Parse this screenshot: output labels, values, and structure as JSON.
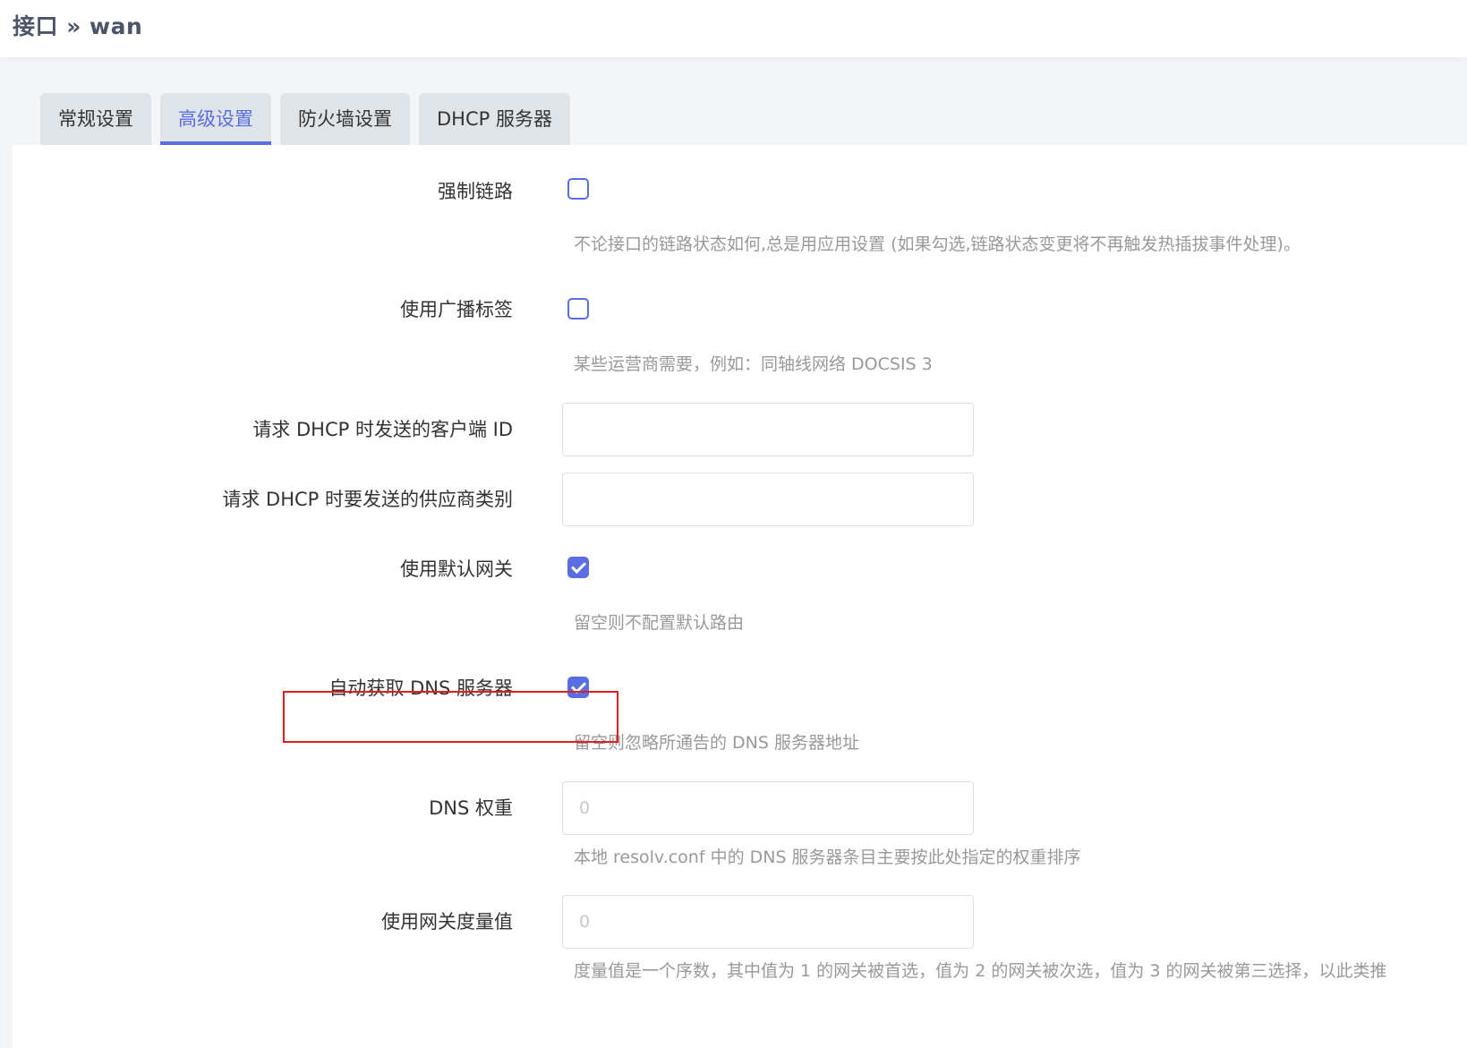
{
  "header": {
    "title": "接口 » wan"
  },
  "tabs": [
    {
      "label": "常规设置"
    },
    {
      "label": "高级设置"
    },
    {
      "label": "防火墙设置"
    },
    {
      "label": "DHCP 服务器"
    }
  ],
  "form": {
    "force_link": {
      "label": "强制链路",
      "checked": false,
      "help": "不论接口的链路状态如何,总是用应用设置 (如果勾选,链路状态变更将不再触发热插拔事件处理)。"
    },
    "broadcast_flag": {
      "label": "使用广播标签",
      "checked": false,
      "help": "某些运营商需要，例如：同轴线网络 DOCSIS 3"
    },
    "client_id": {
      "label": "请求 DHCP 时发送的客户端 ID",
      "value": "",
      "placeholder": ""
    },
    "vendor_class": {
      "label": "请求 DHCP 时要发送的供应商类别",
      "value": "",
      "placeholder": ""
    },
    "default_gateway": {
      "label": "使用默认网关",
      "checked": true,
      "help": "留空则不配置默认路由"
    },
    "peer_dns": {
      "label": "自动获取 DNS 服务器",
      "checked": true,
      "help": "留空则忽略所通告的 DNS 服务器地址"
    },
    "dns_weight": {
      "label": "DNS 权重",
      "value": "",
      "placeholder": "0",
      "help": "本地 resolv.conf 中的 DNS 服务器条目主要按此处指定的权重排序"
    },
    "metric": {
      "label": "使用网关度量值",
      "value": "",
      "placeholder": "0",
      "help": "度量值是一个序数，其中值为 1 的网关被首选，值为 2 的网关被次选，值为 3 的网关被第三选择，以此类推"
    }
  },
  "colors": {
    "accent": "#5b6ee1",
    "highlight": "#e02020",
    "help_text": "#999999"
  }
}
